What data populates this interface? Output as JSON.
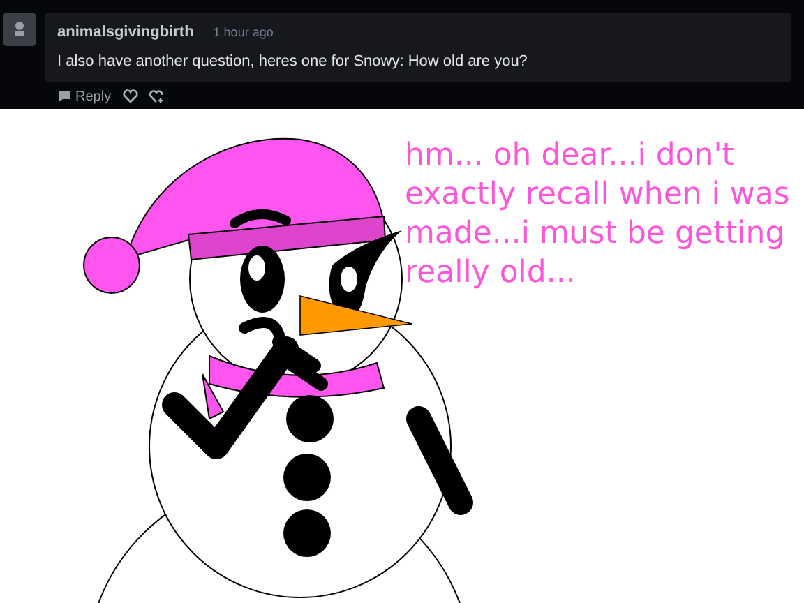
{
  "comment": {
    "author": "animalsgivingbirth",
    "time": "1 hour ago",
    "text": "I also have another question, heres one for Snowy: How old are you?",
    "reply_label": "Reply"
  },
  "artwork": {
    "speech": "hm... oh dear...i don't exactly recall when i was made...i must be getting really old..."
  }
}
